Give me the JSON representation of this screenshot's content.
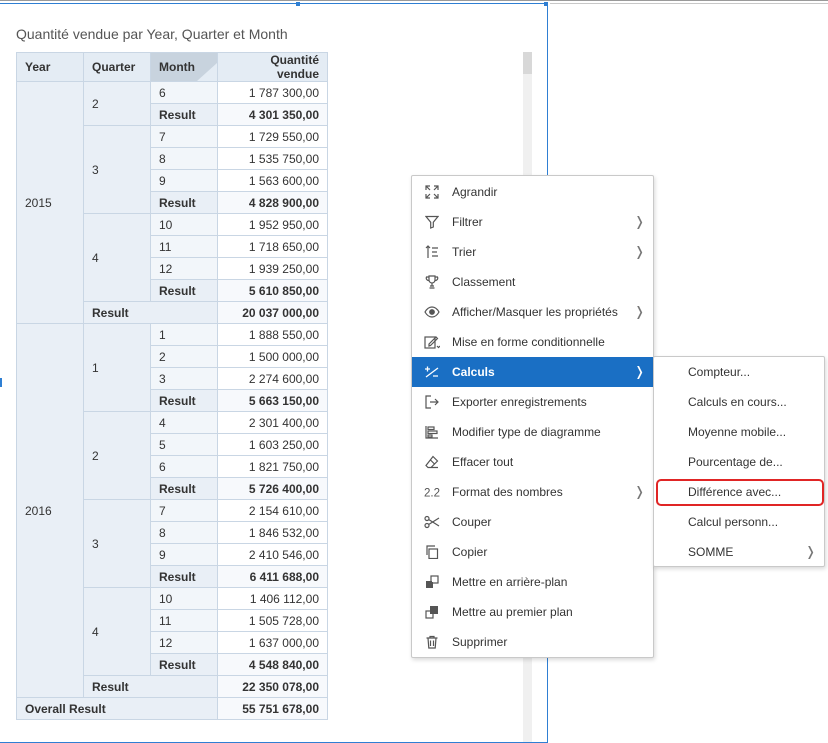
{
  "widget": {
    "title": "Quantité vendue par Year, Quarter et Month"
  },
  "table": {
    "headers": {
      "year": "Year",
      "quarter": "Quarter",
      "month": "Month",
      "value": "Quantité vendue"
    },
    "result_label": "Result",
    "overall_label": "Overall Result",
    "years": [
      {
        "year": "2015",
        "quarters": [
          {
            "q": "2",
            "months": [
              [
                "6",
                "1 787 300,00"
              ]
            ],
            "result": "4 301 350,00"
          },
          {
            "q": "3",
            "months": [
              [
                "7",
                "1 729 550,00"
              ],
              [
                "8",
                "1 535 750,00"
              ],
              [
                "9",
                "1 563 600,00"
              ]
            ],
            "result": "4 828 900,00"
          },
          {
            "q": "4",
            "months": [
              [
                "10",
                "1 952 950,00"
              ],
              [
                "11",
                "1 718 650,00"
              ],
              [
                "12",
                "1 939 250,00"
              ]
            ],
            "result": "5 610 850,00"
          }
        ],
        "result": "20 037 000,00"
      },
      {
        "year": "2016",
        "quarters": [
          {
            "q": "1",
            "months": [
              [
                "1",
                "1 888 550,00"
              ],
              [
                "2",
                "1 500 000,00"
              ],
              [
                "3",
                "2 274 600,00"
              ]
            ],
            "result": "5 663 150,00"
          },
          {
            "q": "2",
            "months": [
              [
                "4",
                "2 301 400,00"
              ],
              [
                "5",
                "1 603 250,00"
              ],
              [
                "6",
                "1 821 750,00"
              ]
            ],
            "result": "5 726 400,00"
          },
          {
            "q": "3",
            "months": [
              [
                "7",
                "2 154 610,00"
              ],
              [
                "8",
                "1 846 532,00"
              ],
              [
                "9",
                "2 410 546,00"
              ]
            ],
            "result": "6 411 688,00"
          },
          {
            "q": "4",
            "months": [
              [
                "10",
                "1 406 112,00"
              ],
              [
                "11",
                "1 505 728,00"
              ],
              [
                "12",
                "1 637 000,00"
              ]
            ],
            "result": "4 548 840,00"
          }
        ],
        "result": "22 350 078,00"
      }
    ],
    "overall": "55 751 678,00"
  },
  "context_menu": {
    "items": [
      {
        "label": "Agrandir",
        "icon": "expand-icon",
        "submenu": false
      },
      {
        "label": "Filtrer",
        "icon": "filter-icon",
        "submenu": true
      },
      {
        "label": "Trier",
        "icon": "sort-icon",
        "submenu": true
      },
      {
        "label": "Classement",
        "icon": "trophy-icon",
        "submenu": false
      },
      {
        "label": "Afficher/Masquer les propriétés",
        "icon": "eye-icon",
        "submenu": true
      },
      {
        "label": "Mise en forme conditionnelle",
        "icon": "conditional-format-icon",
        "submenu": false
      },
      {
        "label": "Calculs",
        "icon": "calculation-icon",
        "submenu": true,
        "active": true
      },
      {
        "label": "Exporter enregistrements",
        "icon": "export-icon",
        "submenu": false
      },
      {
        "label": "Modifier type de diagramme",
        "icon": "chart-type-icon",
        "submenu": false
      },
      {
        "label": "Effacer tout",
        "icon": "eraser-icon",
        "submenu": false
      },
      {
        "label": "Format des nombres",
        "icon": "number-format-icon",
        "submenu": true
      },
      {
        "label": "Couper",
        "icon": "scissors-icon",
        "submenu": false
      },
      {
        "label": "Copier",
        "icon": "copy-icon",
        "submenu": false
      },
      {
        "label": "Mettre en arrière-plan",
        "icon": "send-back-icon",
        "submenu": false
      },
      {
        "label": "Mettre au premier plan",
        "icon": "bring-front-icon",
        "submenu": false
      },
      {
        "label": "Supprimer",
        "icon": "trash-icon",
        "submenu": false
      }
    ]
  },
  "submenu": {
    "items": [
      {
        "label": "Compteur...",
        "submenu": false
      },
      {
        "label": "Calculs en cours...",
        "submenu": false
      },
      {
        "label": "Moyenne mobile...",
        "submenu": false
      },
      {
        "label": "Pourcentage de...",
        "submenu": false
      },
      {
        "label": "Différence avec...",
        "submenu": false,
        "highlighted": true
      },
      {
        "label": "Calcul personn...",
        "submenu": false
      },
      {
        "label": "SOMME",
        "submenu": true
      }
    ]
  },
  "colors": {
    "accent": "#1a6fc4",
    "highlight_outline": "#e02525",
    "header_bg": "#e4ecf4"
  }
}
